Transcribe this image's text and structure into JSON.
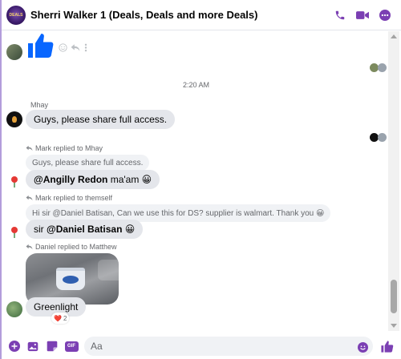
{
  "header": {
    "title": "Sherri Walker 1 (Deals, Deals and more Deals)",
    "avatar_text": "DEALS",
    "icons": [
      "phone-icon",
      "video-icon",
      "more-icon"
    ]
  },
  "colors": {
    "accent": "#7b3fb3",
    "like_blue": "#0866ff",
    "bubble_gray": "#e4e6eb",
    "secondary_text": "#65676b"
  },
  "chat": {
    "timestamp": "2:20 AM",
    "sender_mhay": "Mhay",
    "msg_mhay": "Guys, please share full access.",
    "reply1_label": "Mark replied to Mhay",
    "reply1_quote": "Guys, please share full access.",
    "reply1_mention": "@Angilly Redon",
    "reply1_text": " ma'am 😀",
    "reply2_label": "Mark replied to themself",
    "reply2_quote": "Hi sir @Daniel Batisan, Can we use this for DS? supplier is walmart. Thank you 😀",
    "reply2_prefix": "sir ",
    "reply2_mention": "@Daniel Batisan",
    "reply2_text": " 😀",
    "reply3_label": "Daniel replied to Matthew",
    "msg_greenlight": "Greenlight",
    "reaction_emoji": "❤️",
    "reaction_count": "2"
  },
  "composer": {
    "placeholder": "Aa",
    "icons": [
      "plus-icon",
      "photo-icon",
      "sticker-icon",
      "gif-icon",
      "emoji-icon",
      "like-icon"
    ],
    "gif_label": "GIF"
  }
}
